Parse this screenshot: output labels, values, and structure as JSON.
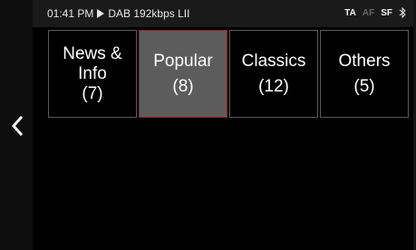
{
  "status_bar": {
    "time": "01:41 PM",
    "source": "DAB 192kbps LII",
    "flags": [
      {
        "label": "TA",
        "active": true
      },
      {
        "label": "AF",
        "active": false
      },
      {
        "label": "SF",
        "active": true
      }
    ],
    "bluetooth_icon": "bluetooth-icon"
  },
  "navigation": {
    "back_icon": "chevron-left-icon"
  },
  "categories": [
    {
      "label": "News & Info",
      "count": "(7)",
      "selected": false
    },
    {
      "label": "Popular",
      "count": "(8)",
      "selected": true
    },
    {
      "label": "Classics",
      "count": "(12)",
      "selected": false
    },
    {
      "label": "Others",
      "count": "(5)",
      "selected": false
    }
  ],
  "colors": {
    "selected_fill": "#5c5c5c",
    "selected_border": "#9a1f1f",
    "tile_border": "#5a5a5a"
  }
}
